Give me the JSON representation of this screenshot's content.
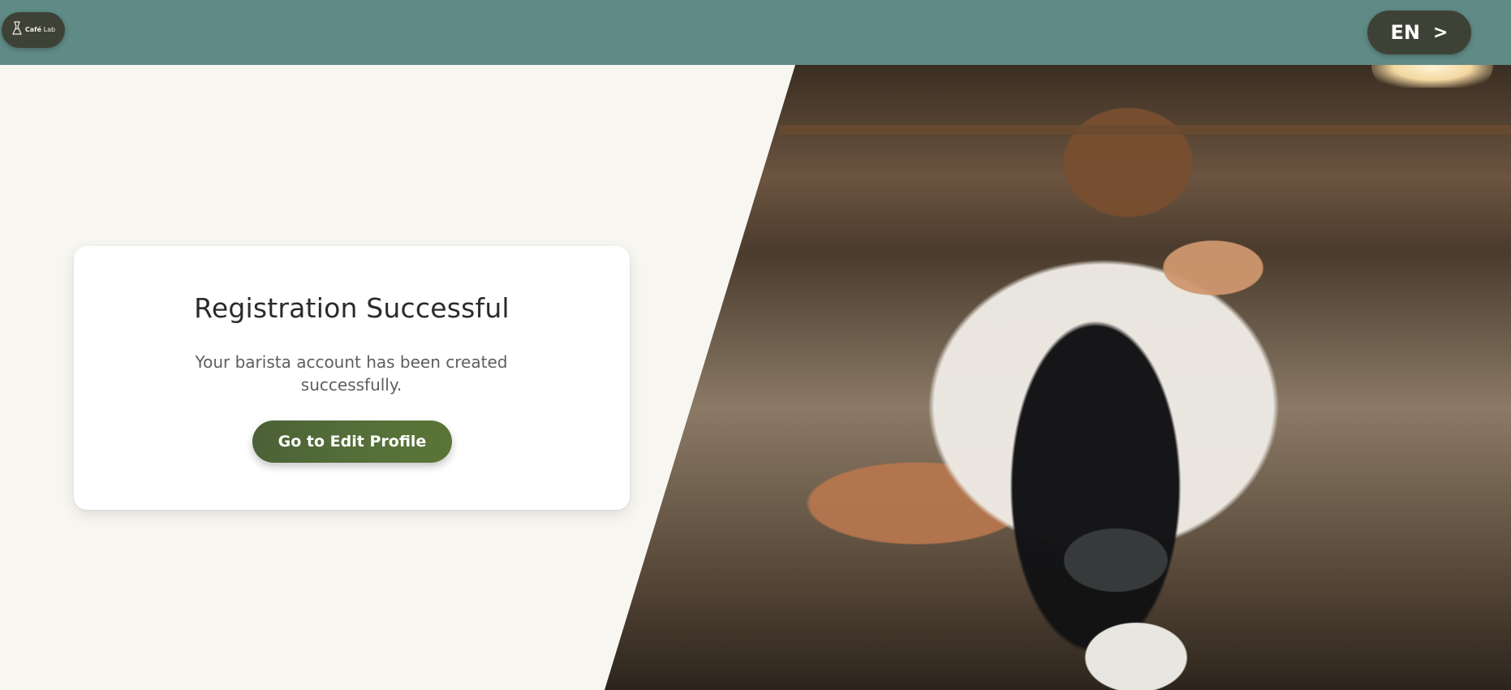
{
  "header": {
    "logo": {
      "icon": "chemex-icon",
      "brand_bold": "Café",
      "brand_light": "Lab"
    },
    "language_button": {
      "label": "EN",
      "chevron": ">"
    }
  },
  "card": {
    "title": "Registration Successful",
    "message": "Your barista account has been created successfully.",
    "button_label": "Go to Edit Profile"
  },
  "colors": {
    "header_bg": "#5f8a86",
    "dark_pill": "#3e4236",
    "page_bg": "#f8f6f1",
    "button_green": "#56703a"
  }
}
